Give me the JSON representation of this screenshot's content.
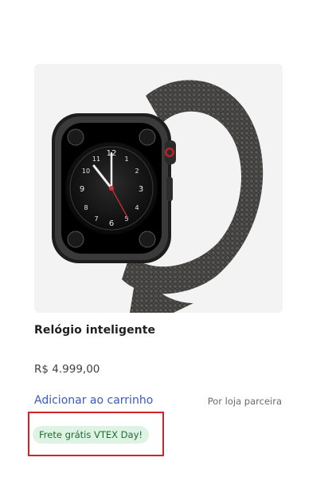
{
  "product": {
    "name": "Relógio inteligente",
    "price": "R$ 4.999,00",
    "add_to_cart_label": "Adicionar ao carrinho",
    "seller_label": "Por loja parceira",
    "shipping_badge": "Frete grátis VTEX Day!"
  },
  "colors": {
    "accent_link": "#3a5bbd",
    "badge_background": "#dff3e4",
    "badge_text": "#1f6b35",
    "highlight_border": "#d0232a"
  }
}
